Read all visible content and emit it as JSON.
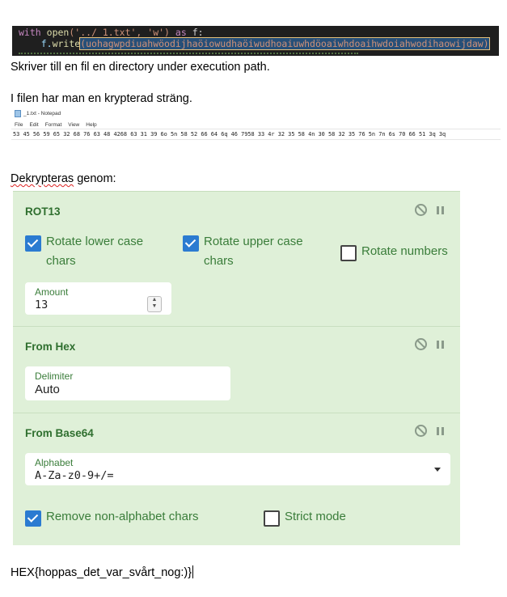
{
  "code": {
    "line1": {
      "kw_with": "with",
      "fn_open": "open",
      "args": "('../_1.txt', 'w')",
      "kw_as": "as",
      "var": "f:"
    },
    "line2": {
      "obj": "f.",
      "fn_write": "write",
      "arg": "(uohagwpdiuahwöodijhaöiowudhaöiwudhoaiuwhdöoaiwhdoaihwdoiahwodihaowijdaw)"
    }
  },
  "text": {
    "p1": "Skriver till en fil en directory under execution path.",
    "p2": "I filen har man en krypterad sträng.",
    "p3_word": "Dekrypteras",
    "p3_rest": " genom:",
    "flag": "HEX{hoppas_det_var_svårt_nog:)}"
  },
  "notepad": {
    "title": "_1.txt - Notepad",
    "menu": [
      "File",
      "Edit",
      "Format",
      "View",
      "Help"
    ],
    "content": "53 45 56 59 65 32 68 76 63 48 4268 63 31 39 6o 5n 58 52 66 64 6q 46 7958 33 4r 32 35 58 4n 30 58 32 35 76 5n 7n 6s 70 66 51 3q 3q"
  },
  "recipe": {
    "rot13": {
      "title": "ROT13",
      "rotate_lower": {
        "label": "Rotate lower case chars",
        "checked": true
      },
      "rotate_upper": {
        "label": "Rotate upper case chars",
        "checked": true
      },
      "rotate_numbers": {
        "label": "Rotate numbers",
        "checked": false
      },
      "amount": {
        "label": "Amount",
        "value": "13"
      }
    },
    "from_hex": {
      "title": "From Hex",
      "delimiter": {
        "label": "Delimiter",
        "value": "Auto"
      }
    },
    "from_base64": {
      "title": "From Base64",
      "alphabet": {
        "label": "Alphabet",
        "value": "A-Za-z0-9+/="
      },
      "remove_non_alphabet": {
        "label": "Remove non-alphabet chars",
        "checked": true
      },
      "strict_mode": {
        "label": "Strict mode",
        "checked": false
      }
    },
    "icons": {
      "disable": "disable-icon",
      "pause": "pause-icon"
    },
    "colors": {
      "panel_bg": "#dff0d8",
      "title": "#2f6f2f",
      "label": "#3a7d3a",
      "checkbox": "#2b7bd1"
    }
  }
}
